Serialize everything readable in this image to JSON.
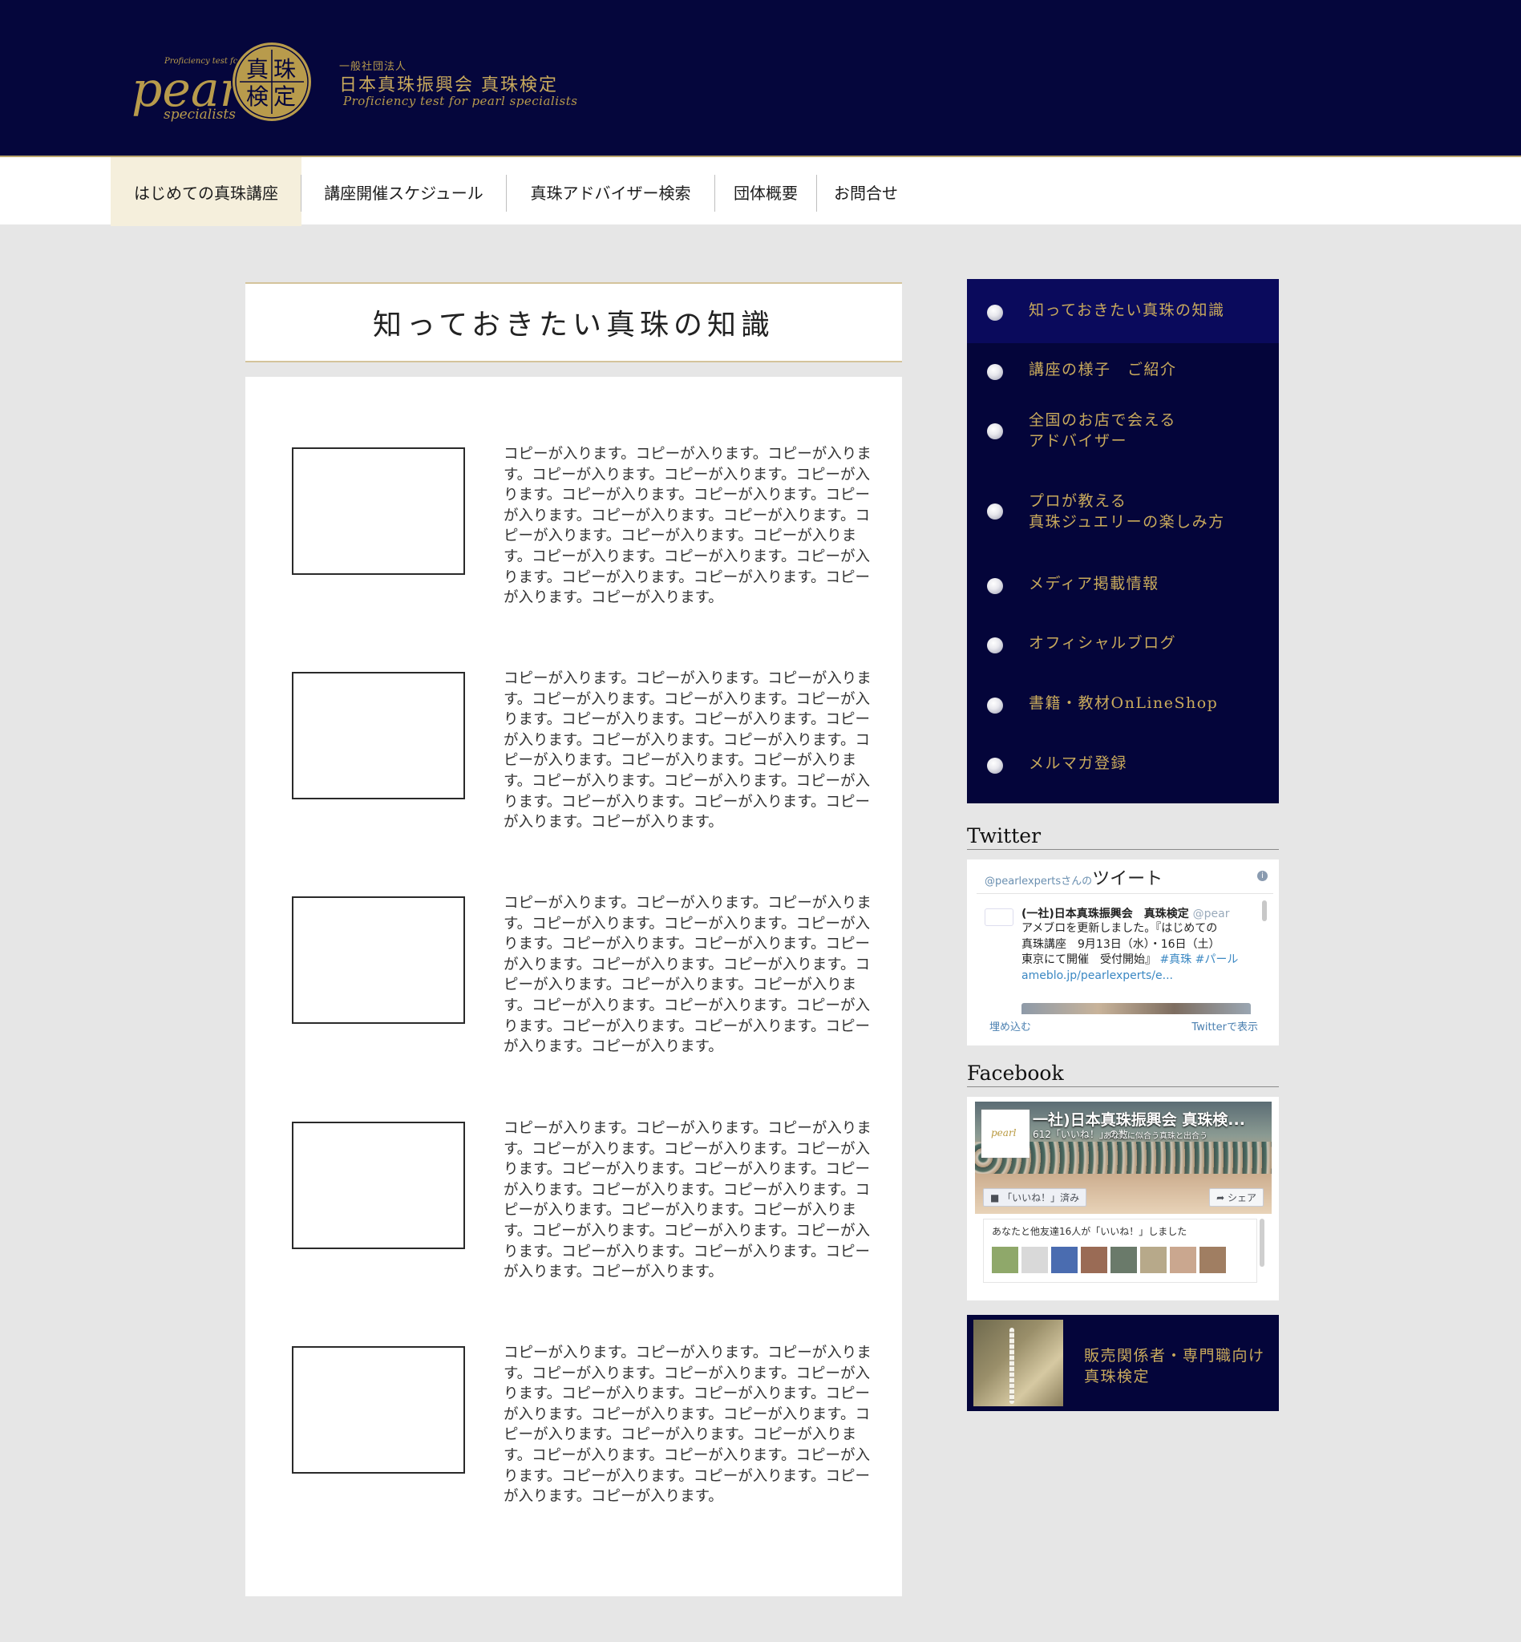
{
  "header": {
    "logo_text_top": "Proficiency test for",
    "logo_text_main": "pearl",
    "logo_text_sub": "specialists",
    "logo_kanji": [
      "真",
      "珠",
      "検",
      "定"
    ],
    "org_small": "一般社団法人",
    "org_name": "日本真珠振興会 真珠検定",
    "org_sub": "Proficiency test for pearl specialists"
  },
  "nav": {
    "items": [
      {
        "label": "はじめての真珠講座"
      },
      {
        "label": "講座開催スケジュール"
      },
      {
        "label": "真珠アドバイザー検索"
      },
      {
        "label": "団体概要"
      },
      {
        "label": "お問合せ"
      }
    ]
  },
  "main": {
    "title": "知っておきたい真珠の知識",
    "items": [
      {
        "text": "コピーが入ります。コピーが入ります。コピーが入ります。コピーが入ります。コピーが入ります。コピーが入ります。コピーが入ります。コピーが入ります。コピーが入ります。コピーが入ります。コピーが入ります。コピーが入ります。コピーが入ります。コピーが入ります。コピーが入ります。コピーが入ります。コピーが入ります。コピーが入ります。コピーが入ります。コピーが入ります。コピーが入ります。"
      },
      {
        "text": "コピーが入ります。コピーが入ります。コピーが入ります。コピーが入ります。コピーが入ります。コピーが入ります。コピーが入ります。コピーが入ります。コピーが入ります。コピーが入ります。コピーが入ります。コピーが入ります。コピーが入ります。コピーが入ります。コピーが入ります。コピーが入ります。コピーが入ります。コピーが入ります。コピーが入ります。コピーが入ります。コピーが入ります。"
      },
      {
        "text": "コピーが入ります。コピーが入ります。コピーが入ります。コピーが入ります。コピーが入ります。コピーが入ります。コピーが入ります。コピーが入ります。コピーが入ります。コピーが入ります。コピーが入ります。コピーが入ります。コピーが入ります。コピーが入ります。コピーが入ります。コピーが入ります。コピーが入ります。コピーが入ります。コピーが入ります。コピーが入ります。コピーが入ります。"
      },
      {
        "text": "コピーが入ります。コピーが入ります。コピーが入ります。コピーが入ります。コピーが入ります。コピーが入ります。コピーが入ります。コピーが入ります。コピーが入ります。コピーが入ります。コピーが入ります。コピーが入ります。コピーが入ります。コピーが入ります。コピーが入ります。コピーが入ります。コピーが入ります。コピーが入ります。コピーが入ります。コピーが入ります。コピーが入ります。"
      },
      {
        "text": "コピーが入ります。コピーが入ります。コピーが入ります。コピーが入ります。コピーが入ります。コピーが入ります。コピーが入ります。コピーが入ります。コピーが入ります。コピーが入ります。コピーが入ります。コピーが入ります。コピーが入ります。コピーが入ります。コピーが入ります。コピーが入ります。コピーが入ります。コピーが入ります。コピーが入ります。コピーが入ります。コピーが入ります。"
      }
    ]
  },
  "sidebar": {
    "menu": [
      {
        "line1": "知っておきたい真珠の知識",
        "line2": ""
      },
      {
        "line1": "講座の様子　ご紹介",
        "line2": ""
      },
      {
        "line1": "全国のお店で会える",
        "line2": "アドバイザー"
      },
      {
        "line1": "プロが教える",
        "line2": "真珠ジュエリーの楽しみ方"
      },
      {
        "line1": "メディア掲載情報",
        "line2": ""
      },
      {
        "line1": "オフィシャルブログ",
        "line2": ""
      },
      {
        "line1": "書籍・教材OnLineShop",
        "line2": ""
      },
      {
        "line1": "メルマガ登録",
        "line2": ""
      }
    ],
    "twitter": {
      "title": "Twitter",
      "head_handle": "@pearlexpertsさんの",
      "head_label": "ツイート",
      "tweet_name": "(一社)日本真珠振興会　真珠検定",
      "tweet_handle": "@pear",
      "tweet_line1": "アメブロを更新しました。『はじめての",
      "tweet_line2": "真珠講座　9月13日（水）・16日（土）",
      "tweet_line3": "東京にて開催　受付開始』",
      "tweet_tags": "#真珠 #パール",
      "tweet_link": "ameblo.jp/pearlexperts/e...",
      "embed_label": "埋め込む",
      "view_label": "Twitterで表示"
    },
    "facebook": {
      "title": "Facebook",
      "page_title": "一社)日本真珠振興会 真珠検...",
      "likes": "612「いいね！」の数",
      "tagline": "あなたに似合う真珠と出合う",
      "like_button": "「いいね！」済み",
      "share_button": "シェア",
      "friends_text": "あなたと他友達16人が「いいね！」しました",
      "logo_text": "pearl"
    },
    "banner": {
      "line1": "販売関係者・専門職向け",
      "line2": "真珠検定"
    }
  },
  "colors": {
    "header_bg": "#05063c",
    "gold": "#c9aa5c",
    "nav_active_bg": "#f5efdc",
    "side_active_bg": "#0a0a5c",
    "page_bg": "#e6e6e6"
  }
}
